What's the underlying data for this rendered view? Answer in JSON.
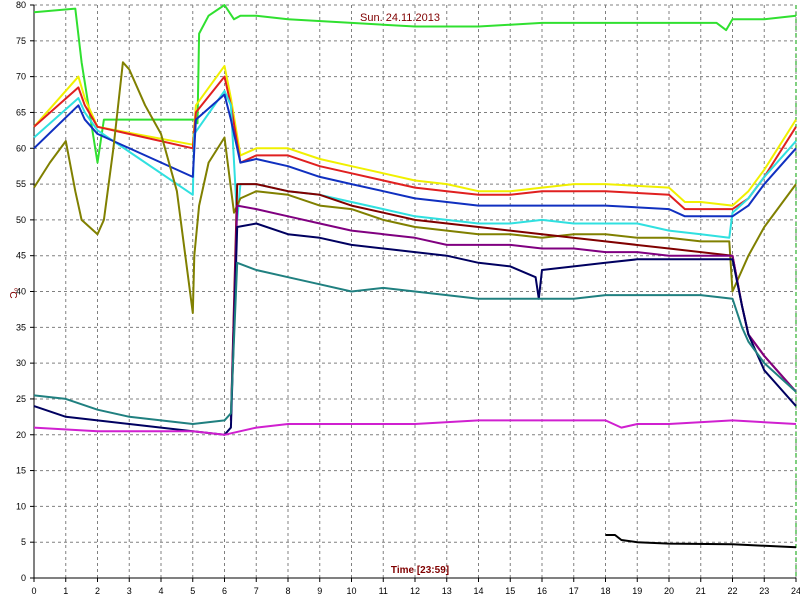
{
  "chart_data": {
    "type": "line",
    "title": "Sun. 24.11.2013",
    "xlabel": "Time [23:59]",
    "ylabel": "°C",
    "xlim": [
      0,
      24
    ],
    "ylim": [
      0,
      80
    ],
    "x_ticks": [
      0,
      1,
      2,
      3,
      4,
      5,
      6,
      7,
      8,
      9,
      10,
      11,
      12,
      13,
      14,
      15,
      16,
      17,
      18,
      19,
      20,
      21,
      22,
      23,
      24
    ],
    "y_ticks": [
      0,
      5,
      10,
      15,
      20,
      25,
      30,
      35,
      40,
      45,
      50,
      55,
      60,
      65,
      70,
      75,
      80
    ],
    "grid": true,
    "colors": {
      "grid": "#808080",
      "axis": "#000000",
      "right_marker": "#00a000"
    },
    "series": [
      {
        "color": "#30e030",
        "x": [
          0,
          1.3,
          1.5,
          2.0,
          2.2,
          5.0,
          5.1,
          5.15,
          5.2,
          5.5,
          6.0,
          6.3,
          6.5,
          7.0,
          8,
          10,
          12,
          14,
          16,
          18,
          20,
          21.5,
          21.8,
          22,
          23,
          24
        ],
        "y": [
          79,
          79.5,
          72,
          58,
          64,
          64,
          64,
          63.5,
          76,
          78.5,
          80,
          78,
          78.5,
          78.5,
          78,
          77.5,
          77,
          77,
          77.5,
          77.5,
          77.5,
          77.5,
          76.5,
          78,
          78,
          78.5
        ]
      },
      {
        "color": "#f0f000",
        "x": [
          0,
          1.4,
          1.6,
          2.0,
          5.0,
          5.1,
          6.0,
          6.2,
          6.5,
          7,
          8,
          9,
          10,
          11,
          12,
          13,
          14,
          15,
          16,
          17,
          18,
          20,
          20.5,
          21,
          22,
          22.5,
          23,
          24
        ],
        "y": [
          63,
          70,
          67,
          63,
          60.5,
          66,
          71.5,
          67,
          59,
          60,
          60,
          58.5,
          57.5,
          56.5,
          55.5,
          55,
          54,
          54,
          54.5,
          55,
          55,
          54.5,
          52.5,
          52.5,
          52,
          54,
          57,
          64
        ]
      },
      {
        "color": "#e02020",
        "x": [
          0,
          1.4,
          1.6,
          2.0,
          5.0,
          5.1,
          6.0,
          6.2,
          6.5,
          7,
          8,
          9,
          10,
          11,
          12,
          13,
          14,
          15,
          16,
          17,
          18,
          20,
          20.5,
          21,
          22,
          22.5,
          23,
          24
        ],
        "y": [
          63,
          68.5,
          66,
          63,
          60,
          65,
          70,
          66,
          58,
          59,
          59,
          57.5,
          56.5,
          55.5,
          54.5,
          54,
          53.5,
          53.5,
          54,
          54,
          54,
          53.5,
          51.5,
          51.5,
          51.5,
          53,
          56,
          63
        ]
      },
      {
        "color": "#30e0e0",
        "x": [
          0,
          1.4,
          1.6,
          2.0,
          5.0,
          5.05,
          6.0,
          6.2,
          6.4,
          6.5,
          7,
          8,
          9,
          10,
          11,
          12,
          13,
          14,
          15,
          16,
          17,
          18,
          19,
          20,
          21,
          21.9,
          22,
          22.5,
          23,
          24
        ],
        "y": [
          61.5,
          67,
          65,
          62.5,
          53.5,
          62,
          68,
          66,
          50,
          55,
          55,
          54,
          53.5,
          52.5,
          51.5,
          50.5,
          50,
          49.5,
          49.5,
          50,
          49.5,
          49.5,
          49.5,
          48.5,
          48,
          47.5,
          51,
          53,
          56,
          61
        ]
      },
      {
        "color": "#1030c0",
        "x": [
          0,
          1.4,
          1.6,
          2.0,
          5.0,
          5.1,
          6.0,
          6.2,
          6.5,
          7,
          8,
          9,
          10,
          11,
          12,
          13,
          14,
          15,
          16,
          17,
          18,
          20,
          20.5,
          21,
          22,
          22.5,
          23,
          24
        ],
        "y": [
          60,
          66,
          64,
          62,
          56,
          64,
          67.5,
          64,
          58,
          58.5,
          57.5,
          56,
          55,
          54,
          53,
          52.5,
          52,
          52,
          52,
          52,
          52,
          51.5,
          50.5,
          50.5,
          50.5,
          52,
          55,
          60
        ]
      },
      {
        "color": "#808000",
        "x": [
          0,
          0.5,
          1.0,
          1.3,
          1.5,
          2.0,
          2.2,
          2.5,
          2.8,
          3,
          3.5,
          4,
          4.5,
          5.0,
          5.05,
          5.2,
          5.5,
          6,
          6.3,
          6.5,
          7,
          8,
          9,
          10,
          11,
          12,
          13,
          14,
          15,
          16,
          17,
          18,
          19,
          20,
          21,
          21.9,
          22,
          22.5,
          23,
          24
        ],
        "y": [
          54.5,
          58,
          61,
          54,
          50,
          48,
          50,
          60,
          72,
          71,
          66,
          62,
          54,
          37,
          45,
          52,
          58,
          61.5,
          51,
          53,
          54,
          53.5,
          52,
          51.5,
          50,
          49,
          48.5,
          48,
          48,
          47.5,
          48,
          48,
          47.5,
          47.5,
          47,
          47,
          40,
          45,
          49,
          55
        ]
      },
      {
        "color": "#800000",
        "x": [
          6.2,
          6.4,
          7,
          8,
          9,
          10,
          11,
          12,
          14,
          16,
          18,
          20,
          22,
          22.3,
          22.5,
          23,
          24
        ],
        "y": [
          22,
          55,
          55,
          54,
          53.5,
          52,
          51,
          50,
          49,
          48,
          47,
          46,
          45,
          38,
          34,
          31,
          26
        ]
      },
      {
        "color": "#800080",
        "x": [
          6.2,
          6.4,
          7,
          8,
          9,
          10,
          11,
          12,
          13,
          14,
          15,
          16,
          17,
          18,
          19,
          20,
          21,
          22,
          22.3,
          22.5,
          23,
          24
        ],
        "y": [
          22,
          52,
          51.5,
          50.5,
          49.5,
          48.5,
          48,
          47.5,
          46.5,
          46.5,
          46.5,
          46,
          46,
          45.5,
          45.5,
          45,
          45,
          45,
          38,
          34,
          31,
          26
        ]
      },
      {
        "color": "#000060",
        "x": [
          0,
          1,
          2,
          3,
          4,
          5,
          6,
          6.2,
          6.4,
          7,
          8,
          9,
          10,
          11,
          12,
          13,
          14,
          15,
          15.8,
          15.9,
          16,
          17,
          18,
          19,
          20,
          21,
          22,
          22.3,
          22.5,
          23,
          24
        ],
        "y": [
          24,
          22.5,
          22,
          21.5,
          21,
          20.5,
          20,
          21,
          49,
          49.5,
          48,
          47.5,
          46.5,
          46,
          45.5,
          45,
          44,
          43.5,
          42,
          39,
          43,
          43.5,
          44,
          44.5,
          44.5,
          44.5,
          44.5,
          38,
          34,
          29,
          24
        ]
      },
      {
        "color": "#208080",
        "x": [
          0,
          1,
          2,
          3,
          4,
          5,
          6,
          6.2,
          6.4,
          7,
          8,
          9,
          10,
          11,
          12,
          13,
          14,
          15,
          16,
          17,
          18,
          19,
          20,
          21,
          22,
          22.3,
          22.5,
          23,
          24
        ],
        "y": [
          25.5,
          25,
          23.5,
          22.5,
          22,
          21.5,
          22,
          23,
          44,
          43,
          42,
          41,
          40,
          40.5,
          40,
          39.5,
          39,
          39,
          39,
          39,
          39.5,
          39.5,
          39.5,
          39.5,
          39,
          35,
          33,
          30,
          26
        ]
      },
      {
        "color": "#d020d0",
        "x": [
          0,
          2,
          4,
          5,
          6,
          6.5,
          7,
          8,
          10,
          12,
          14,
          16,
          17,
          18,
          18.5,
          19,
          20,
          22,
          24
        ],
        "y": [
          21,
          20.5,
          20.5,
          20.5,
          20,
          20.5,
          21,
          21.5,
          21.5,
          21.5,
          22,
          22,
          22,
          22,
          21,
          21.5,
          21.5,
          22,
          21.5
        ]
      },
      {
        "color": "#000000",
        "x": [
          18,
          18.3,
          18.5,
          19,
          20,
          22,
          24
        ],
        "y": [
          6,
          6,
          5.3,
          5,
          4.8,
          4.7,
          4.3
        ]
      }
    ]
  }
}
